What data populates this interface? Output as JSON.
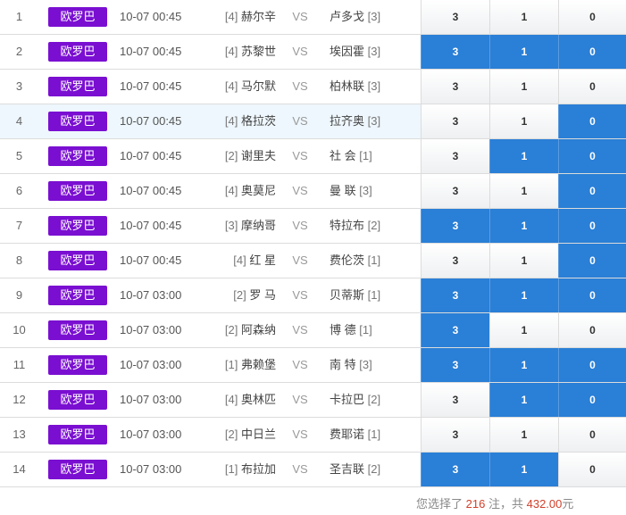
{
  "rows": [
    {
      "idx": "1",
      "league": "欧罗巴",
      "time": "10-07 00:45",
      "home_rank": "[4]",
      "home": "赫尔辛",
      "vs": "VS",
      "away": "卢多戈",
      "away_rank": "[3]",
      "odds": [
        "3",
        "1",
        "0"
      ],
      "selected": [
        false,
        false,
        false
      ],
      "highlight": false
    },
    {
      "idx": "2",
      "league": "欧罗巴",
      "time": "10-07 00:45",
      "home_rank": "[4]",
      "home": "苏黎世",
      "vs": "VS",
      "away": "埃因霍",
      "away_rank": "[3]",
      "odds": [
        "3",
        "1",
        "0"
      ],
      "selected": [
        true,
        true,
        true
      ],
      "highlight": false
    },
    {
      "idx": "3",
      "league": "欧罗巴",
      "time": "10-07 00:45",
      "home_rank": "[4]",
      "home": "马尔默",
      "vs": "VS",
      "away": "柏林联",
      "away_rank": "[3]",
      "odds": [
        "3",
        "1",
        "0"
      ],
      "selected": [
        false,
        false,
        false
      ],
      "highlight": false
    },
    {
      "idx": "4",
      "league": "欧罗巴",
      "time": "10-07 00:45",
      "home_rank": "[4]",
      "home": "格拉茨",
      "vs": "VS",
      "away": "拉齐奥",
      "away_rank": "[3]",
      "odds": [
        "3",
        "1",
        "0"
      ],
      "selected": [
        false,
        false,
        true
      ],
      "highlight": true
    },
    {
      "idx": "5",
      "league": "欧罗巴",
      "time": "10-07 00:45",
      "home_rank": "[2]",
      "home": "谢里夫",
      "vs": "VS",
      "away": "社 会",
      "away_rank": "[1]",
      "odds": [
        "3",
        "1",
        "0"
      ],
      "selected": [
        false,
        true,
        true
      ],
      "highlight": false
    },
    {
      "idx": "6",
      "league": "欧罗巴",
      "time": "10-07 00:45",
      "home_rank": "[4]",
      "home": "奥莫尼",
      "vs": "VS",
      "away": "曼 联",
      "away_rank": "[3]",
      "odds": [
        "3",
        "1",
        "0"
      ],
      "selected": [
        false,
        false,
        true
      ],
      "highlight": false
    },
    {
      "idx": "7",
      "league": "欧罗巴",
      "time": "10-07 00:45",
      "home_rank": "[3]",
      "home": "摩纳哥",
      "vs": "VS",
      "away": "特拉布",
      "away_rank": "[2]",
      "odds": [
        "3",
        "1",
        "0"
      ],
      "selected": [
        true,
        true,
        true
      ],
      "highlight": false
    },
    {
      "idx": "8",
      "league": "欧罗巴",
      "time": "10-07 00:45",
      "home_rank": "[4]",
      "home": "红 星",
      "vs": "VS",
      "away": "费伦茨",
      "away_rank": "[1]",
      "odds": [
        "3",
        "1",
        "0"
      ],
      "selected": [
        false,
        false,
        true
      ],
      "highlight": false
    },
    {
      "idx": "9",
      "league": "欧罗巴",
      "time": "10-07 03:00",
      "home_rank": "[2]",
      "home": "罗 马",
      "vs": "VS",
      "away": "贝蒂斯",
      "away_rank": "[1]",
      "odds": [
        "3",
        "1",
        "0"
      ],
      "selected": [
        true,
        true,
        true
      ],
      "highlight": false
    },
    {
      "idx": "10",
      "league": "欧罗巴",
      "time": "10-07 03:00",
      "home_rank": "[2]",
      "home": "阿森纳",
      "vs": "VS",
      "away": "博 德",
      "away_rank": "[1]",
      "odds": [
        "3",
        "1",
        "0"
      ],
      "selected": [
        true,
        false,
        false
      ],
      "highlight": false
    },
    {
      "idx": "11",
      "league": "欧罗巴",
      "time": "10-07 03:00",
      "home_rank": "[1]",
      "home": "弗赖堡",
      "vs": "VS",
      "away": "南 特",
      "away_rank": "[3]",
      "odds": [
        "3",
        "1",
        "0"
      ],
      "selected": [
        true,
        true,
        true
      ],
      "highlight": false
    },
    {
      "idx": "12",
      "league": "欧罗巴",
      "time": "10-07 03:00",
      "home_rank": "[4]",
      "home": "奥林匹",
      "vs": "VS",
      "away": "卡拉巴",
      "away_rank": "[2]",
      "odds": [
        "3",
        "1",
        "0"
      ],
      "selected": [
        false,
        true,
        true
      ],
      "highlight": false
    },
    {
      "idx": "13",
      "league": "欧罗巴",
      "time": "10-07 03:00",
      "home_rank": "[2]",
      "home": "中日兰",
      "vs": "VS",
      "away": "费耶诺",
      "away_rank": "[1]",
      "odds": [
        "3",
        "1",
        "0"
      ],
      "selected": [
        false,
        false,
        false
      ],
      "highlight": false
    },
    {
      "idx": "14",
      "league": "欧罗巴",
      "time": "10-07 03:00",
      "home_rank": "[1]",
      "home": "布拉加",
      "vs": "VS",
      "away": "圣吉联",
      "away_rank": "[2]",
      "odds": [
        "3",
        "1",
        "0"
      ],
      "selected": [
        true,
        true,
        false
      ],
      "highlight": false
    }
  ],
  "summary": {
    "prefix": "您选择了",
    "count": "216",
    "middle": "注，共",
    "amount": "432.00",
    "suffix": "元"
  },
  "colors": {
    "league_badge": "#7a0fd1",
    "selected_odd": "#2a7fd6",
    "highlight_row": "#eef7fd",
    "summary_number": "#d0402a"
  }
}
